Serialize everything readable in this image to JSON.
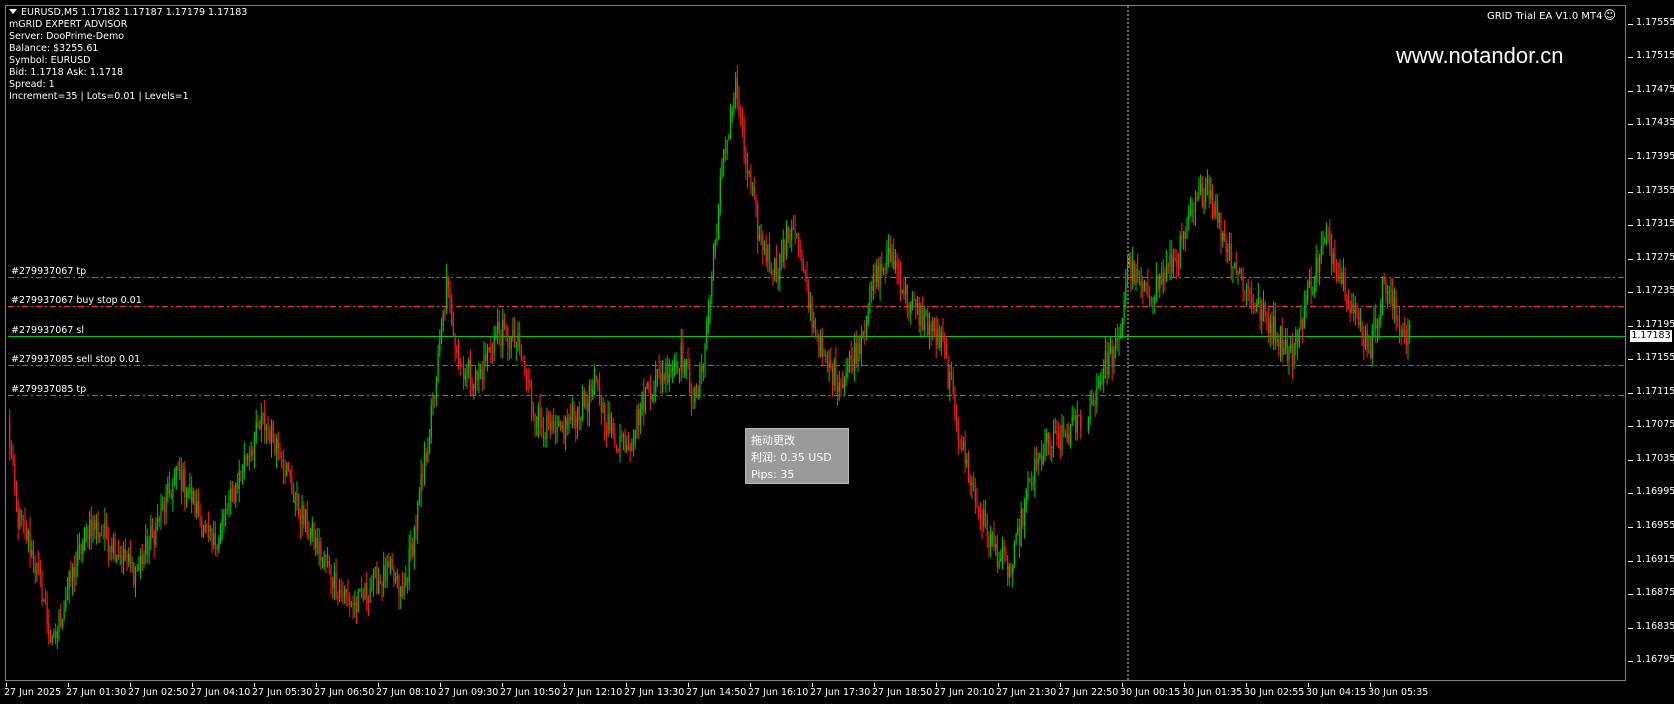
{
  "chart_info": {
    "symbol_line": "EURUSD,M5  1.17182 1.17187 1.17179 1.17183",
    "ea_title": "mGRID EXPERT ADVISOR",
    "server": "Server: DooPrime-Demo",
    "balance": "Balance: $3255.61",
    "symbol": "Symbol: EURUSD",
    "bid_ask": "Bid: 1.1718 Ask: 1.1718",
    "spread": "Spread: 1",
    "params": "Increment=35 | Lots=0.01 | Levels=1"
  },
  "ea_label": "GRID Trial EA  V1.0 MT4",
  "watermark": "www.notandor.cn",
  "order_lines": [
    {
      "label": "#279937067 tp",
      "price": 1.17253,
      "color": "#00c000",
      "style": "dashdot"
    },
    {
      "label": "#279937067 buy stop 0.01",
      "price": 1.17218,
      "color": "#ff3030",
      "style": "dashdot"
    },
    {
      "label": "#279937067 sl",
      "price": 1.17183,
      "color": "#00d000",
      "style": "solid"
    },
    {
      "label": "#279937085 sell stop 0.01",
      "price": 1.17148,
      "color": "#ff3030",
      "style": "dashdot"
    },
    {
      "label": "#279937085 tp",
      "price": 1.17113,
      "color": "#00c000",
      "style": "dashdot"
    }
  ],
  "tooltip": {
    "line1": "拖动更改",
    "line2": "利润:   0.35 USD",
    "line3": "Pips:  35"
  },
  "colors": {
    "background": "#000000",
    "bull": "#00c800",
    "bear": "#ff1e1e",
    "grid": "#808080",
    "text": "#ffffff"
  },
  "chart_data": {
    "type": "candlestick",
    "symbol": "EURUSD",
    "timeframe": "M5",
    "ylim": [
      1.16775,
      1.17575
    ],
    "current_price": "1.17183",
    "y_ticks": [
      "1.17555",
      "1.17515",
      "1.17475",
      "1.17435",
      "1.17395",
      "1.17355",
      "1.17315",
      "1.17275",
      "1.17235",
      "1.17195",
      "1.17155",
      "1.17115",
      "1.17075",
      "1.17035",
      "1.16995",
      "1.16955",
      "1.16915",
      "1.16875",
      "1.16835",
      "1.16795"
    ],
    "x_ticks": [
      "27 Jun 2025",
      "27 Jun 01:30",
      "27 Jun 02:50",
      "27 Jun 04:10",
      "27 Jun 05:30",
      "27 Jun 06:50",
      "27 Jun 08:10",
      "27 Jun 09:30",
      "27 Jun 10:50",
      "27 Jun 12:10",
      "27 Jun 13:30",
      "27 Jun 14:50",
      "27 Jun 16:10",
      "27 Jun 17:30",
      "27 Jun 18:50",
      "27 Jun 20:10",
      "27 Jun 21:30",
      "27 Jun 22:50",
      "30 Jun 00:15",
      "30 Jun 01:35",
      "30 Jun 02:55",
      "30 Jun 04:15",
      "30 Jun 05:35"
    ],
    "close_path": [
      [
        0,
        1.1708
      ],
      [
        5,
        1.1697
      ],
      [
        12,
        1.1694
      ],
      [
        20,
        1.1688
      ],
      [
        26,
        1.1681
      ],
      [
        35,
        1.1688
      ],
      [
        48,
        1.1696
      ],
      [
        60,
        1.1694
      ],
      [
        75,
        1.169
      ],
      [
        88,
        1.1696
      ],
      [
        100,
        1.1702
      ],
      [
        108,
        1.1699
      ],
      [
        120,
        1.1693
      ],
      [
        130,
        1.1698
      ],
      [
        140,
        1.1704
      ],
      [
        150,
        1.1708
      ],
      [
        160,
        1.1705
      ],
      [
        170,
        1.1698
      ],
      [
        182,
        1.1693
      ],
      [
        195,
        1.1688
      ],
      [
        205,
        1.1686
      ],
      [
        215,
        1.1689
      ],
      [
        225,
        1.169
      ],
      [
        232,
        1.1687
      ],
      [
        240,
        1.1696
      ],
      [
        250,
        1.171
      ],
      [
        258,
        1.1724
      ],
      [
        266,
        1.1715
      ],
      [
        276,
        1.1713
      ],
      [
        288,
        1.1719
      ],
      [
        300,
        1.1717
      ],
      [
        310,
        1.1709
      ],
      [
        322,
        1.1706
      ],
      [
        334,
        1.1709
      ],
      [
        346,
        1.1712
      ],
      [
        356,
        1.1706
      ],
      [
        366,
        1.1706
      ],
      [
        376,
        1.1712
      ],
      [
        386,
        1.1714
      ],
      [
        396,
        1.1716
      ],
      [
        405,
        1.171
      ],
      [
        412,
        1.1721
      ],
      [
        420,
        1.1738
      ],
      [
        428,
        1.1748
      ],
      [
        434,
        1.1739
      ],
      [
        442,
        1.173
      ],
      [
        452,
        1.1726
      ],
      [
        462,
        1.1732
      ],
      [
        470,
        1.1723
      ],
      [
        480,
        1.1715
      ],
      [
        490,
        1.1713
      ],
      [
        500,
        1.1717
      ],
      [
        510,
        1.1725
      ],
      [
        520,
        1.1728
      ],
      [
        530,
        1.1722
      ],
      [
        540,
        1.172
      ],
      [
        550,
        1.1717
      ],
      [
        560,
        1.1706
      ],
      [
        570,
        1.1698
      ],
      [
        580,
        1.1693
      ],
      [
        590,
        1.169
      ],
      [
        600,
        1.17
      ],
      [
        610,
        1.1705
      ],
      [
        620,
        1.1706
      ],
      [
        630,
        1.1708
      ],
      [
        642,
        1.1715
      ],
      [
        650,
        1.1717
      ],
      [
        655,
        1.1727
      ],
      [
        665,
        1.1723
      ],
      [
        675,
        1.1725
      ],
      [
        685,
        1.1728
      ],
      [
        694,
        1.1733
      ],
      [
        702,
        1.1737
      ],
      [
        710,
        1.1731
      ],
      [
        720,
        1.1726
      ],
      [
        730,
        1.1722
      ],
      [
        742,
        1.1719
      ],
      [
        752,
        1.1716
      ],
      [
        762,
        1.1724
      ],
      [
        772,
        1.173
      ],
      [
        782,
        1.1725
      ],
      [
        790,
        1.172
      ],
      [
        798,
        1.1717
      ],
      [
        806,
        1.1725
      ],
      [
        814,
        1.172
      ],
      [
        822,
        1.1718
      ]
    ]
  }
}
